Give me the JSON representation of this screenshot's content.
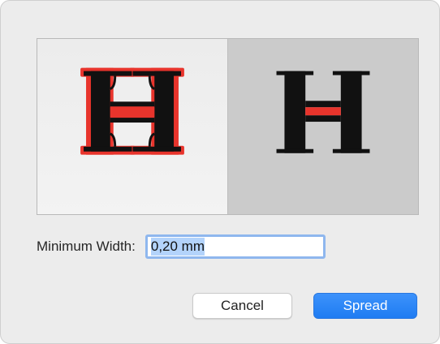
{
  "preview": {
    "before_glyph": "H",
    "after_glyph": "H",
    "highlight_color": "#e8342c",
    "glyph_color": "#111111"
  },
  "minimum_width": {
    "label": "Minimum Width:",
    "value": "0,20 mm"
  },
  "buttons": {
    "cancel_label": "Cancel",
    "spread_label": "Spread"
  },
  "colors": {
    "accent": "#2a86f6",
    "focus_ring": "#8fb7ee"
  }
}
